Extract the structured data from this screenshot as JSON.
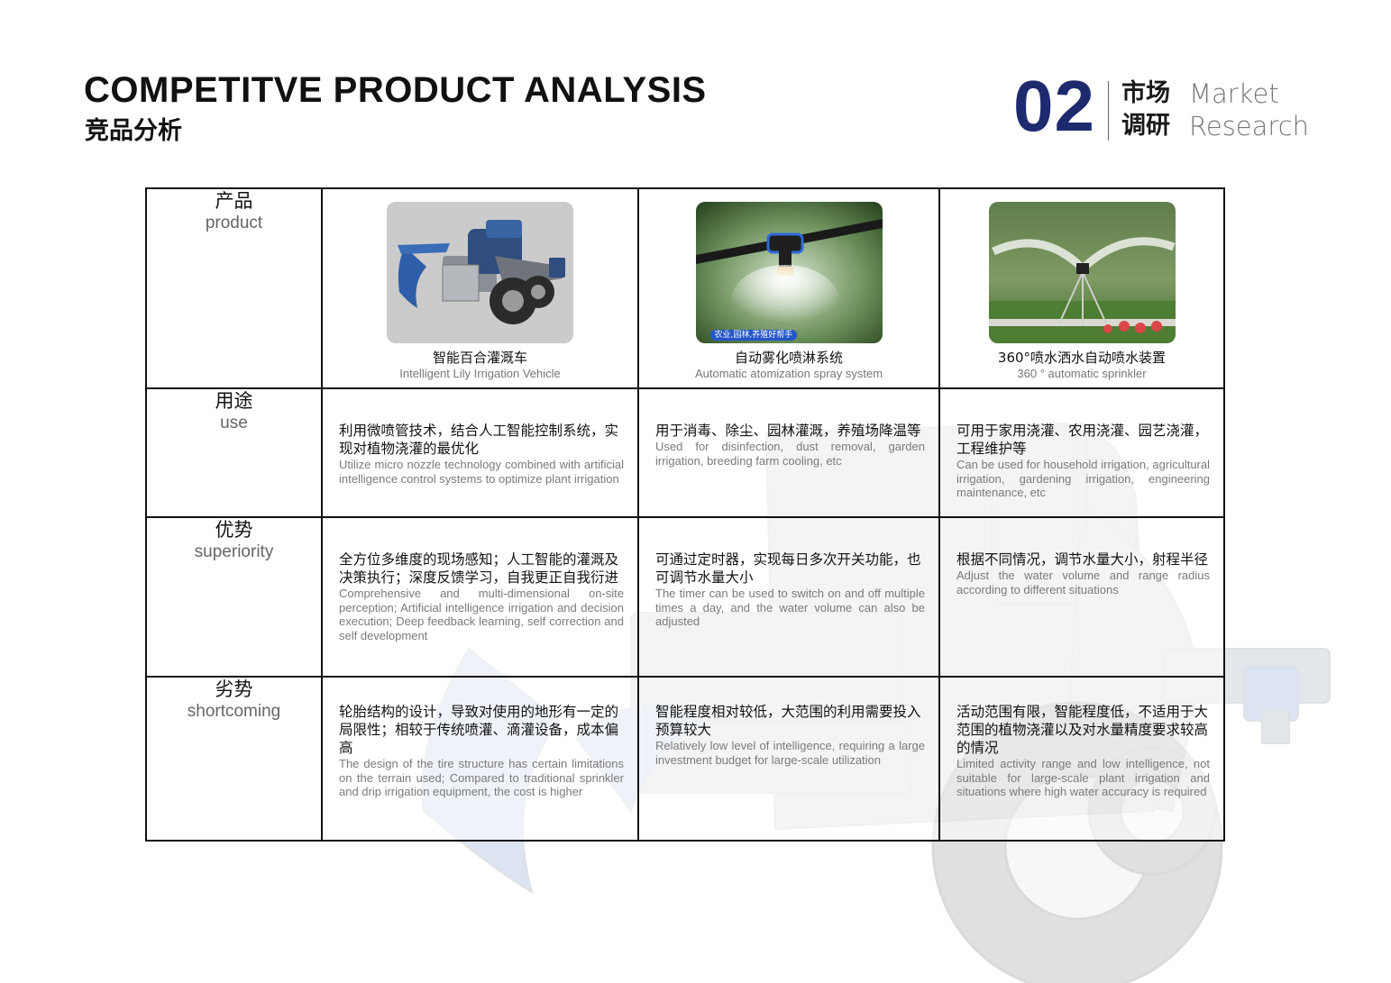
{
  "header": {
    "title_en": "COMPETITVE PRODUCT ANALYSIS",
    "title_cn": "竞品分析"
  },
  "section": {
    "number": "02",
    "label_cn_1": "市场",
    "label_cn_2": "调研",
    "label_en_1": "Market",
    "label_en_2": "Research"
  },
  "row_headers": [
    {
      "cn": "产品",
      "en": "product"
    },
    {
      "cn": "用途",
      "en": "use"
    },
    {
      "cn": "优势",
      "en": "superiority"
    },
    {
      "cn": "劣势",
      "en": "shortcoming"
    }
  ],
  "products": [
    {
      "name_cn": "智能百合灌溉车",
      "name_en": "Intelligent Lily Irrigation Vehicle",
      "image": "irrigation-vehicle-render",
      "use_cn": "利用微喷管技术，结合人工智能控制系统，实现对植物浇灌的最优化",
      "use_en": "Utilize micro nozzle technology combined with artificial intelligence control systems to optimize plant irrigation",
      "sup_cn": "全方位多维度的现场感知；人工智能的灌溉及决策执行；深度反馈学习，自我更正自我衍进",
      "sup_en": "Comprehensive and multi-dimensional on-site perception; Artificial intelligence irrigation and decision execution; Deep feedback learning, self correction and self development",
      "short_cn": "轮胎结构的设计，导致对使用的地形有一定的局限性；相较于传统喷灌、滴灌设备，成本偏高",
      "short_en": "The design of the tire structure has certain limitations on the terrain used; Compared to traditional sprinkler and drip irrigation equipment, the cost is higher"
    },
    {
      "name_cn": "自动雾化喷淋系统",
      "name_en": "Automatic atomization spray system",
      "image": "mist-nozzle-photo",
      "image_tag": "农业,园林,养殖好帮手",
      "use_cn": "用于消毒、除尘、园林灌溉，养殖场降温等",
      "use_en": "Used for disinfection, dust removal, garden irrigation, breeding farm cooling, etc",
      "sup_cn": "可通过定时器，实现每日多次开关功能，也可调节水量大小",
      "sup_en": "The timer can be used to switch on and off multiple times a day, and the water volume can also be adjusted",
      "short_cn": "智能程度相对较低，大范围的利用需要投入预算较大",
      "short_en": "Relatively low level of intelligence, requiring a large investment budget for large-scale utilization"
    },
    {
      "name_cn": "360°喷水洒水自动喷水装置",
      "name_en": "360 ° automatic sprinkler",
      "image": "sprinkler-garden-photo",
      "use_cn": "可用于家用浇灌、农用浇灌、园艺浇灌，工程维护等",
      "use_en": "Can be used for household irrigation, agricultural irrigation, gardening irrigation, engineering maintenance, etc",
      "sup_cn": "根据不同情况，调节水量大小，射程半径",
      "sup_en": "Adjust the water volume and range radius according to different situations",
      "short_cn": "活动范围有限，智能程度低，不适用于大范围的植物浇灌以及对水量精度要求较高的情况",
      "short_en": "Limited activity range and low intelligence, not suitable for large-scale plant irrigation and situations where high water accuracy is required"
    }
  ],
  "colors": {
    "accent": "#1d2a6e",
    "border": "#111111",
    "muted_text": "#7a7a7a"
  }
}
